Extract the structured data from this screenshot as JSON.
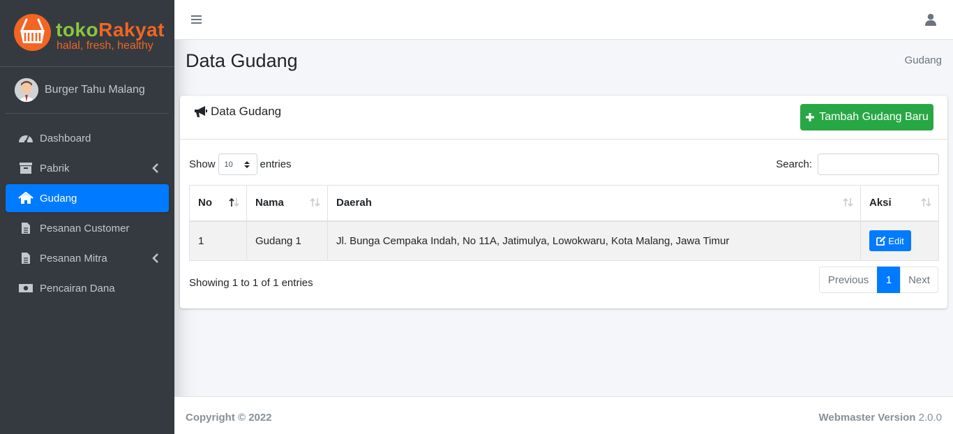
{
  "brand": {
    "name_part1": "toko",
    "name_part2": "Rakyat",
    "tagline": "halal, fresh, healthy"
  },
  "user": {
    "name": "Burger Tahu Malang"
  },
  "sidebar": {
    "items": [
      {
        "label": "Dashboard",
        "icon": "tachometer-icon"
      },
      {
        "label": "Pabrik",
        "icon": "archive-icon"
      },
      {
        "label": "Gudang",
        "icon": "home-icon"
      },
      {
        "label": "Pesanan Customer",
        "icon": "file-icon"
      },
      {
        "label": "Pesanan Mitra",
        "icon": "file-icon"
      },
      {
        "label": "Pencairan Dana",
        "icon": "money-icon"
      }
    ]
  },
  "page": {
    "title": "Data Gudang",
    "breadcrumb": "Gudang"
  },
  "card": {
    "title": "Data Gudang",
    "add_button": "Tambah Gudang Baru"
  },
  "table_controls": {
    "show_label": "Show",
    "entries_value": "10",
    "entries_label": "entries",
    "search_label": "Search:"
  },
  "table": {
    "headers": [
      "No",
      "Nama",
      "Daerah",
      "Aksi"
    ],
    "rows": [
      {
        "no": "1",
        "nama": "Gudang 1",
        "daerah": "Jl. Bunga Cempaka Indah, No 11A, Jatimulya, Lowokwaru, Kota Malang, Jawa Timur",
        "action": "Edit"
      }
    ]
  },
  "pagination": {
    "info": "Showing 1 to 1 of 1 entries",
    "previous": "Previous",
    "current": "1",
    "next": "Next"
  },
  "footer": {
    "copyright": "Copyright © 2022",
    "version_label": "Webmaster Version",
    "version": "2.0.0"
  },
  "colors": {
    "sidebar_bg": "#343a40",
    "active": "#007bff",
    "success": "#28a745",
    "brand_orange": "#f26522",
    "brand_green": "#8cc63f"
  }
}
